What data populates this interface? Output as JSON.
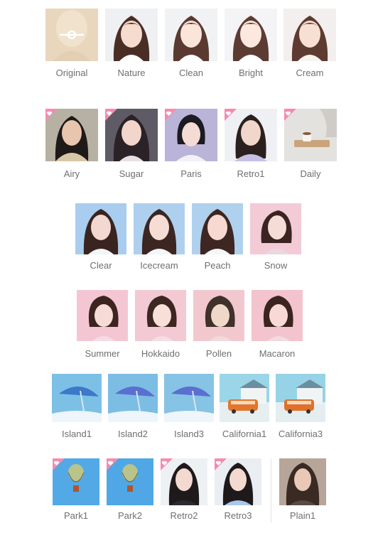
{
  "colors": {
    "label": "#6f6f6f",
    "premium_badge": "#f58bb0",
    "original_tint": "#e9d6bb"
  },
  "filters": {
    "row1": [
      {
        "label": "Original",
        "bg": "#e9d7bd",
        "icon": "compare-slider-icon"
      },
      {
        "label": "Nature",
        "bg": "#eef0f2"
      },
      {
        "label": "Clean",
        "bg": "#f1f2f4"
      },
      {
        "label": "Bright",
        "bg": "#f4f4f6"
      },
      {
        "label": "Cream",
        "bg": "#f3efee"
      }
    ],
    "row2": [
      {
        "label": "Airy",
        "bg": "#b7b1a3",
        "premium": true
      },
      {
        "label": "Sugar",
        "bg": "#5e5a66",
        "premium": true
      },
      {
        "label": "Paris",
        "bg": "#b9b4d8",
        "premium": true
      },
      {
        "label": "Retro1",
        "bg": "#eef0f4",
        "premium": true
      },
      {
        "label": "Daily",
        "bg": "#dcdad7",
        "premium": true
      }
    ],
    "row3": [
      {
        "label": "Clear",
        "bg": "#a9cdef"
      },
      {
        "label": "Icecream",
        "bg": "#aed0ee"
      },
      {
        "label": "Peach",
        "bg": "#afd1ee"
      },
      {
        "label": "Snow",
        "bg": "#f2cbd6"
      }
    ],
    "row4": [
      {
        "label": "Summer",
        "bg": "#f4c6d3"
      },
      {
        "label": "Hokkaido",
        "bg": "#f3c9d3"
      },
      {
        "label": "Pollen",
        "bg": "#f2c8cf"
      },
      {
        "label": "Macaron",
        "bg": "#f3c4cd"
      }
    ],
    "row5": [
      {
        "label": "Island1",
        "bg": "#7dc0e6"
      },
      {
        "label": "Island2",
        "bg": "#7cbde3"
      },
      {
        "label": "Island3",
        "bg": "#86c3e4"
      },
      {
        "label": "California1",
        "bg": "#9bd6e8"
      },
      {
        "label": "California3",
        "bg": "#96d3e7"
      }
    ],
    "row6": [
      {
        "label": "Park1",
        "bg": "#52a9e6",
        "premium": true
      },
      {
        "label": "Park2",
        "bg": "#4fa8e5",
        "premium": true
      },
      {
        "label": "Retro2",
        "bg": "#eef1f4",
        "premium": true
      },
      {
        "label": "Retro3",
        "bg": "#eaeef2",
        "premium": true
      },
      {
        "label": "Plain1",
        "bg": "#b7a59a"
      }
    ]
  }
}
